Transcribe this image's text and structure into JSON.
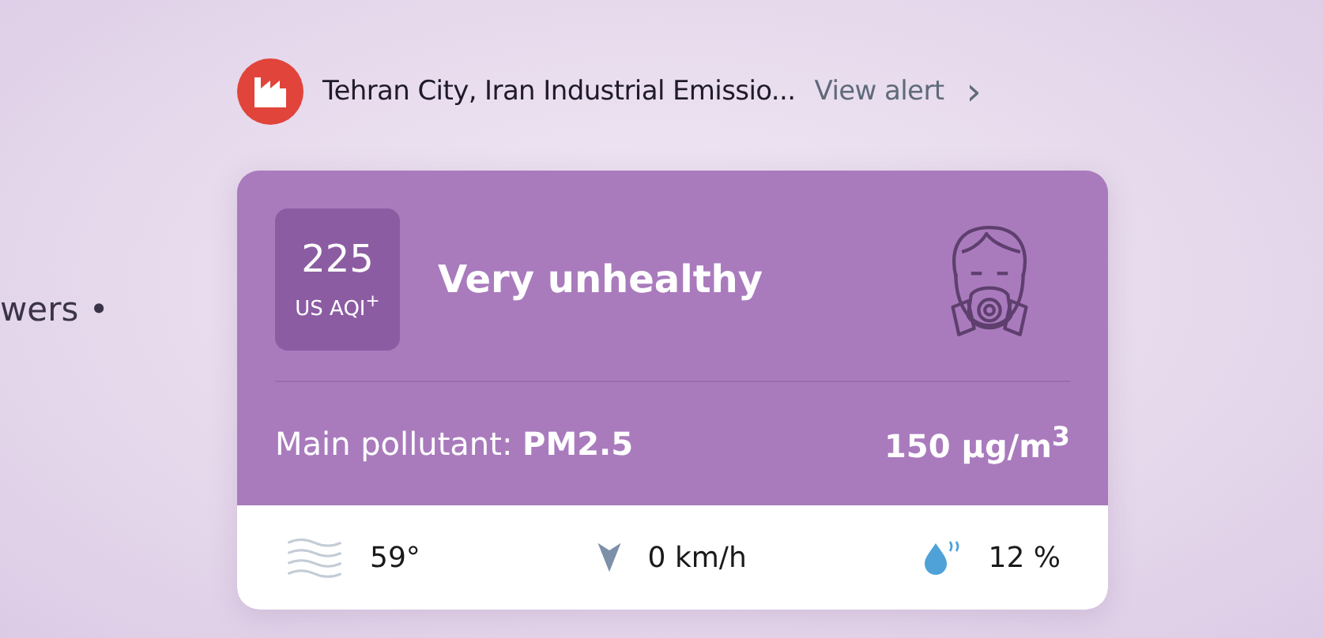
{
  "side_text": "wers •",
  "alert": {
    "title": "Tehran City, Iran Industrial Emissio...",
    "link": "View alert",
    "chevron": "›"
  },
  "aqi": {
    "value": "225",
    "unit": "US AQI$^{+}$",
    "category": "Very unhealthy",
    "pollutant_label": "Main pollutant:",
    "pollutant": "PM2.5",
    "concentration": "150 µg/m$^{3}$"
  },
  "conditions": [
    {
      "kind": "temperature",
      "text": "59°"
    },
    {
      "kind": "wind",
      "text": "0 km/h"
    },
    {
      "kind": "humidity",
      "text": "12 %"
    }
  ]
}
